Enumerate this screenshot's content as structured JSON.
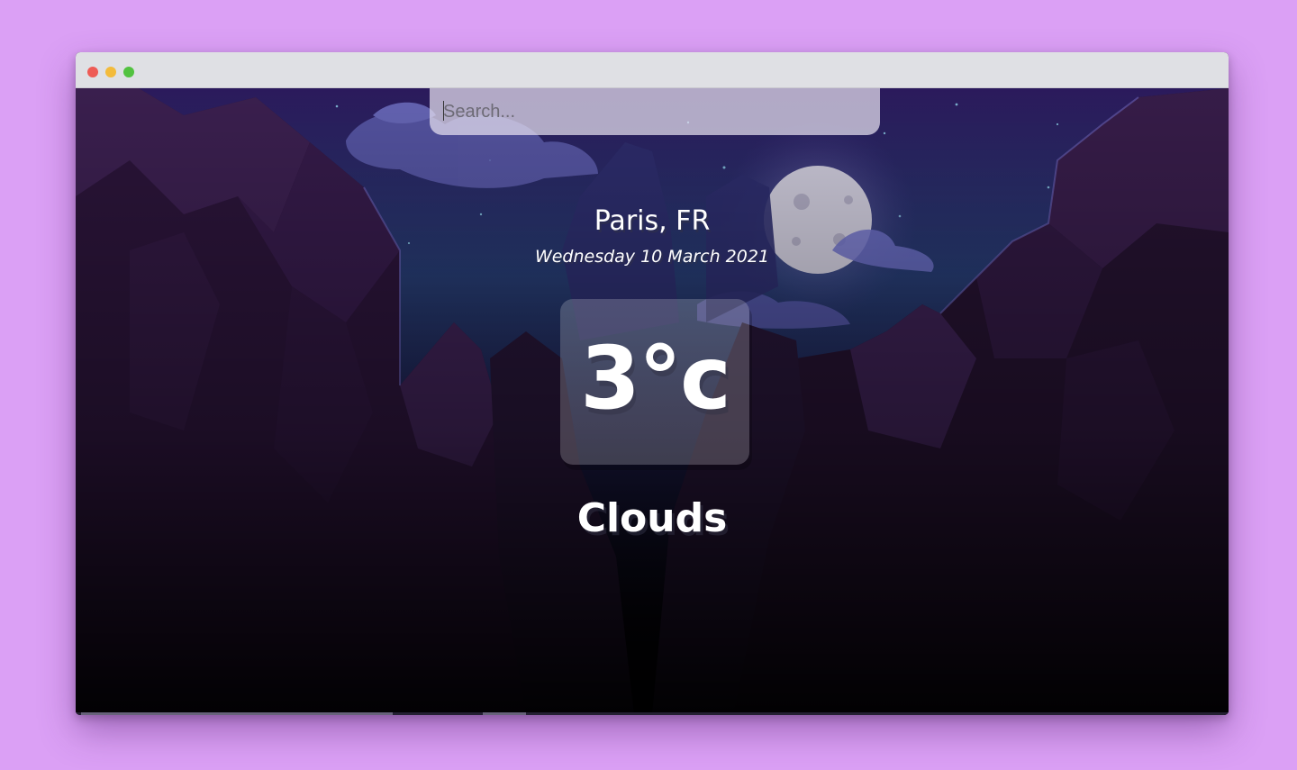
{
  "window": {
    "controls": [
      "close",
      "minimize",
      "maximize"
    ]
  },
  "search": {
    "placeholder": "Search...",
    "value": ""
  },
  "weather": {
    "location": "Paris, FR",
    "date": "Wednesday 10 March 2021",
    "temperature": "3°c",
    "condition": "Clouds"
  },
  "background": {
    "scene": "night canyon with full moon and clouds",
    "icons": [
      "moon-icon"
    ]
  },
  "colors": {
    "page_bg": "#dba0f5",
    "titlebar": "#dfe0e4",
    "close": "#ee5b55",
    "minimize": "#f3bb3b",
    "maximize": "#52c240",
    "text": "#ffffff"
  }
}
